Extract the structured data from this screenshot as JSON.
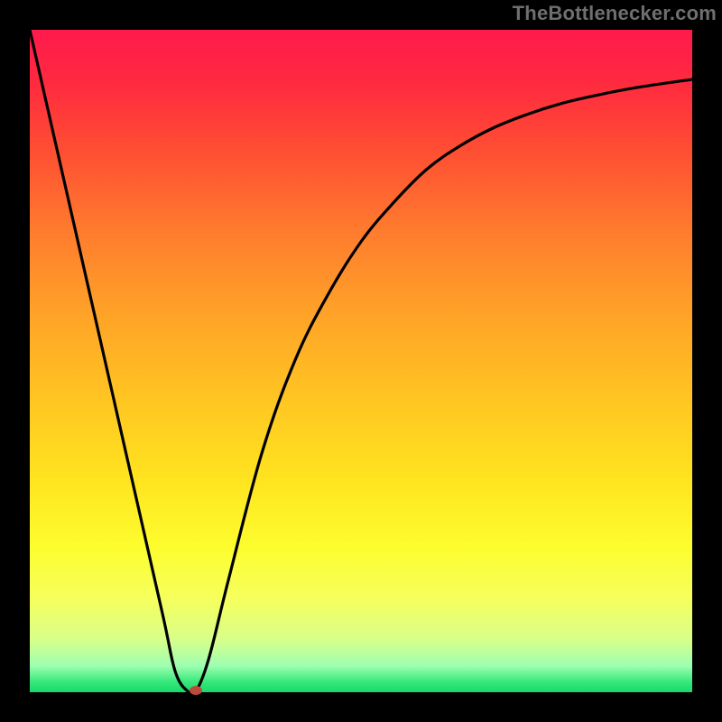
{
  "watermark": "TheBottlenecker.com",
  "chart_data": {
    "type": "line",
    "title": "",
    "xlabel": "",
    "ylabel": "",
    "xlim": [
      0,
      100
    ],
    "ylim": [
      0,
      100
    ],
    "x": [
      0,
      5,
      10,
      15,
      20,
      22,
      24,
      25,
      27,
      30,
      35,
      40,
      45,
      50,
      55,
      60,
      65,
      70,
      75,
      80,
      85,
      90,
      95,
      100
    ],
    "y": [
      100,
      78,
      56,
      34,
      12,
      3,
      0,
      0,
      5,
      17,
      36,
      50,
      60,
      68,
      74,
      79,
      82.5,
      85.2,
      87.2,
      88.8,
      90,
      91,
      91.8,
      92.5
    ],
    "marker": {
      "x": 25,
      "y": 0
    },
    "gradient_stops": [
      {
        "pos": 0.0,
        "color": "#ff1a4d"
      },
      {
        "pos": 0.5,
        "color": "#ffc322"
      },
      {
        "pos": 1.0,
        "color": "#18d86a"
      }
    ]
  }
}
